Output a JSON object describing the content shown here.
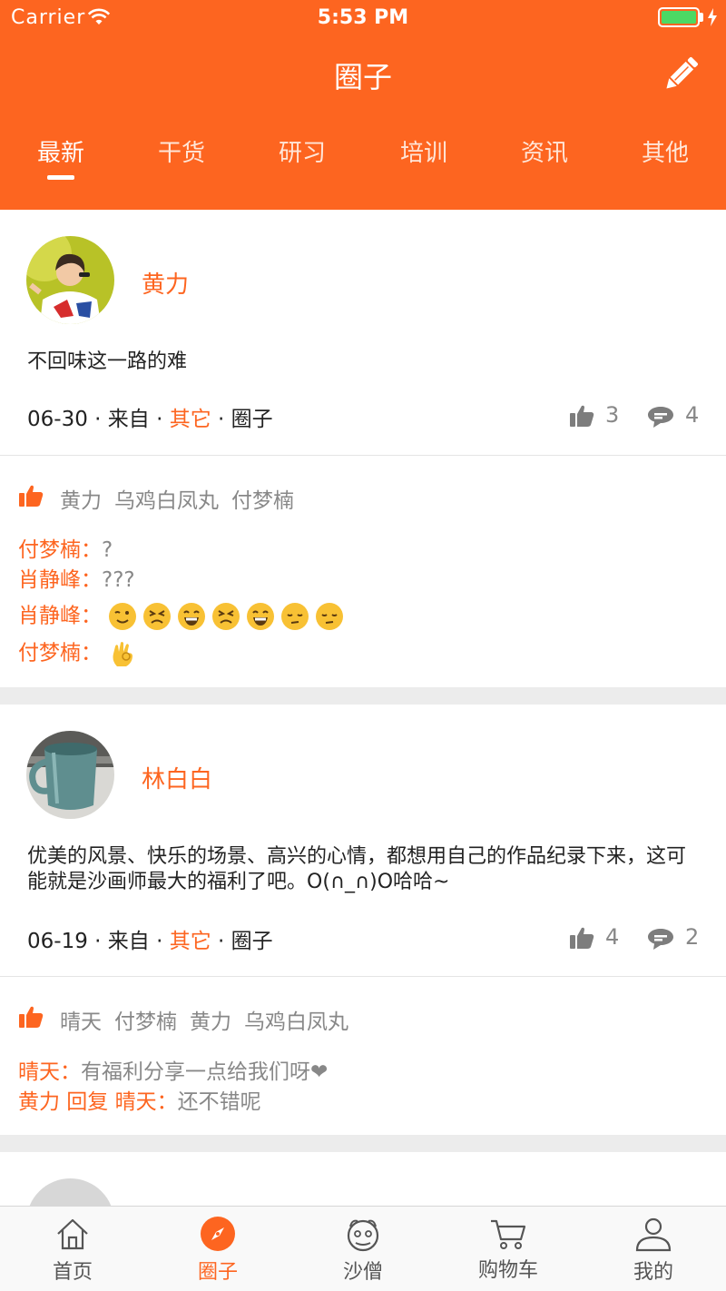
{
  "status_bar": {
    "carrier": "Carrier",
    "time": "5:53 PM",
    "battery_color": "#4cd964"
  },
  "header": {
    "title": "圈子",
    "tabs": [
      {
        "label": "最新",
        "active": true
      },
      {
        "label": "干货",
        "active": false
      },
      {
        "label": "研习",
        "active": false
      },
      {
        "label": "培训",
        "active": false
      },
      {
        "label": "资讯",
        "active": false
      },
      {
        "label": "其他",
        "active": false
      }
    ]
  },
  "theme": {
    "accent": "#fd6520",
    "muted": "#888888",
    "separator": "#ececec"
  },
  "posts": [
    {
      "author": "黄力",
      "content": "不回味这一路的难",
      "date": "06-30",
      "from_prefix": " · 来自 · ",
      "source": "其它",
      "channel_sep": " · ",
      "channel": "圈子",
      "likes": "3",
      "comments": "4",
      "likers": [
        "黄力",
        "乌鸡白凤丸",
        "付梦楠"
      ],
      "comment_list": [
        {
          "name": "付梦楠：",
          "text": "?"
        },
        {
          "name": "肖静峰：",
          "text": "???"
        },
        {
          "name": "肖静峰：",
          "text": "",
          "emojis": [
            "wink",
            "persevere",
            "grin",
            "persevere",
            "grin",
            "pensive",
            "pensive"
          ]
        },
        {
          "name": "付梦楠：",
          "text": "",
          "emojis": [
            "ok-hand"
          ]
        }
      ]
    },
    {
      "author": "林白白",
      "content": "优美的风景、快乐的场景、高兴的心情，都想用自己的作品纪录下来，这可能就是沙画师最大的福利了吧。O(∩_∩)O哈哈~",
      "date": "06-19",
      "from_prefix": " · 来自 · ",
      "source": "其它",
      "channel_sep": " · ",
      "channel": "圈子",
      "likes": "4",
      "comments": "2",
      "likers": [
        "晴天",
        "付梦楠",
        "黄力",
        "乌鸡白凤丸"
      ],
      "comment_list": [
        {
          "name": "晴天：",
          "text": "有福利分享一点给我们呀❤"
        },
        {
          "name": "黄力 回复 晴天：",
          "text": "还不错呢"
        }
      ]
    }
  ],
  "tabbar": [
    {
      "label": "首页",
      "icon": "home-icon",
      "active": false
    },
    {
      "label": "圈子",
      "icon": "compass-icon",
      "active": true
    },
    {
      "label": "沙僧",
      "icon": "monk-icon",
      "active": false
    },
    {
      "label": "购物车",
      "icon": "cart-icon",
      "active": false
    },
    {
      "label": "我的",
      "icon": "person-icon",
      "active": false
    }
  ]
}
